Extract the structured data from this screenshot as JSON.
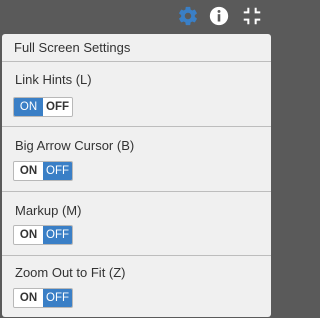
{
  "toolbar": {
    "icons": [
      "gear-icon",
      "info-icon",
      "exit-fullscreen-icon"
    ],
    "colors": {
      "gear": "#3a7fc6",
      "info": "#ffffff",
      "fullscreen": "#ffffff"
    }
  },
  "panel": {
    "title": "Full Screen Settings",
    "settings": [
      {
        "label": "Link Hints (L)",
        "on_label": "ON",
        "off_label": "OFF",
        "state": "on"
      },
      {
        "label": "Big Arrow Cursor (B)",
        "on_label": "ON",
        "off_label": "OFF",
        "state": "off"
      },
      {
        "label": "Markup (M)",
        "on_label": "ON",
        "off_label": "OFF",
        "state": "off"
      },
      {
        "label": "Zoom Out to Fit (Z)",
        "on_label": "ON",
        "off_label": "OFF",
        "state": "off"
      }
    ]
  },
  "colors": {
    "accent": "#3a7fc6",
    "panel_bg": "#f0f0f0",
    "frame_bg": "#5a5a5a"
  }
}
